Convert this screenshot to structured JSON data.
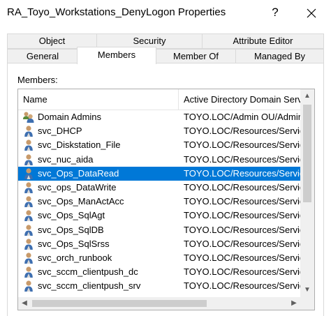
{
  "window": {
    "title": "RA_Toyo_Workstations_DenyLogon Properties",
    "help_label": "?"
  },
  "tabs_back": [
    {
      "label": "Object"
    },
    {
      "label": "Security"
    },
    {
      "label": "Attribute Editor"
    }
  ],
  "tabs_front": [
    {
      "label": "General"
    },
    {
      "label": "Members",
      "active": true
    },
    {
      "label": "Member Of"
    },
    {
      "label": "Managed By"
    }
  ],
  "members_label": "Members:",
  "columns": {
    "name": "Name",
    "ad_folder": "Active Directory Domain Servi"
  },
  "rows": [
    {
      "name": "Domain Admins",
      "path": "TOYO.LOC/Admin OU/Admin",
      "icon": "group-icon"
    },
    {
      "name": "svc_DHCP",
      "path": "TOYO.LOC/Resources/Servic",
      "icon": "user-icon"
    },
    {
      "name": "svc_Diskstation_File",
      "path": "TOYO.LOC/Resources/Servic",
      "icon": "user-icon"
    },
    {
      "name": "svc_nuc_aida",
      "path": "TOYO.LOC/Resources/Servic",
      "icon": "user-icon"
    },
    {
      "name": "svc_Ops_DataRead",
      "path": "TOYO.LOC/Resources/Servic",
      "icon": "user-icon",
      "selected": true
    },
    {
      "name": "svc_ops_DataWrite",
      "path": "TOYO.LOC/Resources/Servic",
      "icon": "user-icon"
    },
    {
      "name": "svc_Ops_ManActAcc",
      "path": "TOYO.LOC/Resources/Servic",
      "icon": "user-icon"
    },
    {
      "name": "svc_Ops_SqlAgt",
      "path": "TOYO.LOC/Resources/Servic",
      "icon": "user-icon"
    },
    {
      "name": "svc_Ops_SqlDB",
      "path": "TOYO.LOC/Resources/Servic",
      "icon": "user-icon"
    },
    {
      "name": "svc_Ops_SqlSrss",
      "path": "TOYO.LOC/Resources/Servic",
      "icon": "user-icon"
    },
    {
      "name": "svc_orch_runbook",
      "path": "TOYO.LOC/Resources/Servic",
      "icon": "user-icon"
    },
    {
      "name": "svc_sccm_clientpush_dc",
      "path": "TOYO.LOC/Resources/Servic",
      "icon": "user-icon"
    },
    {
      "name": "svc_sccm_clientpush_srv",
      "path": "TOYO.LOC/Resources/Servic",
      "icon": "user-icon"
    }
  ],
  "colors": {
    "selection": "#0078d7",
    "tab_inactive": "#f0f0f0",
    "border": "#d9d9d9"
  }
}
